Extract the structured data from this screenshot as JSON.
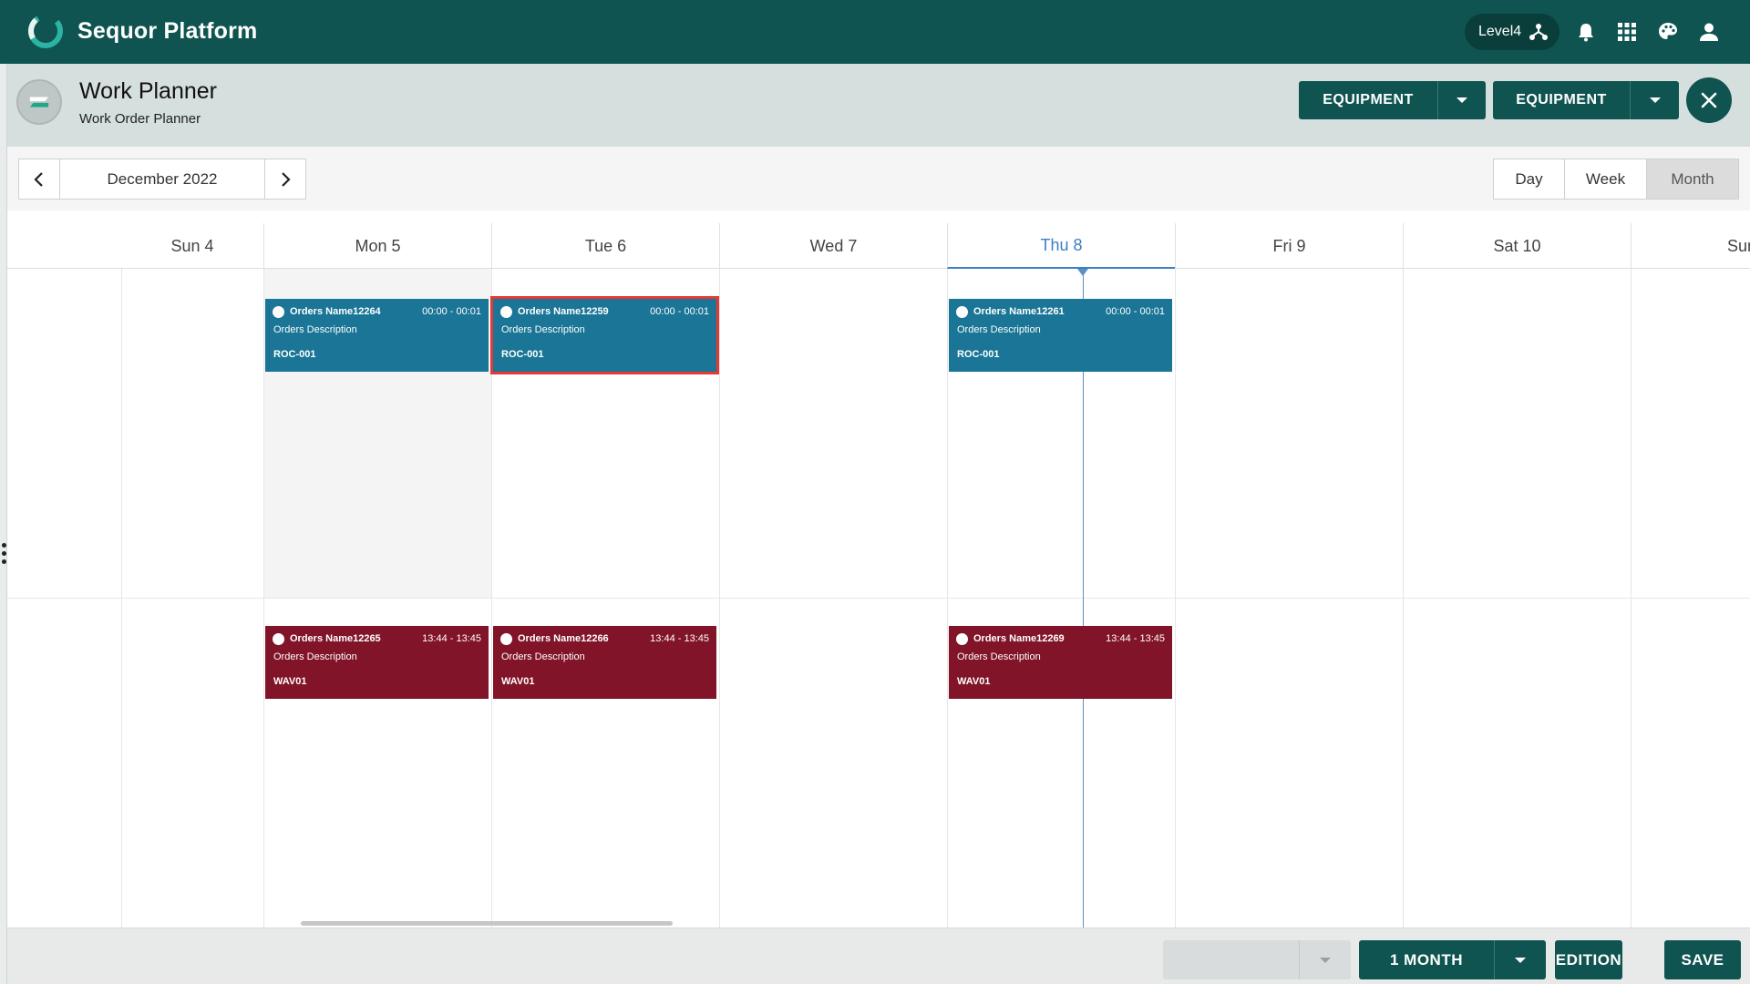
{
  "app": {
    "title": "Sequor Platform",
    "level_chip": "Level4"
  },
  "page": {
    "title": "Work Planner",
    "subtitle": "Work Order Planner"
  },
  "header_actions": {
    "filter1_label": "EQUIPMENT",
    "filter2_label": "EQUIPMENT"
  },
  "toolbar": {
    "date_label": "December 2022",
    "views": [
      "Day",
      "Week",
      "Month"
    ],
    "active_view": "Month"
  },
  "calendar": {
    "days": [
      "Sun 4",
      "Mon 5",
      "Tue 6",
      "Wed 7",
      "Thu 8",
      "Fri 9",
      "Sat 10",
      "Sun"
    ],
    "today": "Thu 8",
    "events": [
      {
        "name": "Orders Name12264",
        "time": "00:00 - 00:01",
        "desc": "Orders Description",
        "code": "ROC-001",
        "color": "#1a7596",
        "selected": false
      },
      {
        "name": "Orders Name12259",
        "time": "00:00 - 00:01",
        "desc": "Orders Description",
        "code": "ROC-001",
        "color": "#1a7596",
        "selected": true
      },
      {
        "name": "Orders Name12261",
        "time": "00:00 - 00:01",
        "desc": "Orders Description",
        "code": "ROC-001",
        "color": "#1a7596",
        "selected": false
      },
      {
        "name": "Orders Name12265",
        "time": "13:44 - 13:45",
        "desc": "Orders Description",
        "code": "WAV01",
        "color": "#811428",
        "selected": false
      },
      {
        "name": "Orders Name12266",
        "time": "13:44 - 13:45",
        "desc": "Orders Description",
        "code": "WAV01",
        "color": "#811428",
        "selected": false
      },
      {
        "name": "Orders Name12269",
        "time": "13:44 - 13:45",
        "desc": "Orders Description",
        "code": "WAV01",
        "color": "#811428",
        "selected": false
      }
    ]
  },
  "footer": {
    "range_label": "1 MONTH",
    "edition_label": "EDITION",
    "save_label": "SAVE"
  },
  "colors": {
    "primary": "#0f5450",
    "event_blue": "#1a7596",
    "event_red": "#811428",
    "today": "#3b7fc4",
    "selection": "#e53935"
  },
  "icons": [
    "logo-ring-icon",
    "hierarchy-icon",
    "bell-icon",
    "apps-grid-icon",
    "palette-icon",
    "user-icon",
    "close-icon",
    "chevron-left-icon",
    "chevron-right-icon",
    "caret-down-icon"
  ]
}
